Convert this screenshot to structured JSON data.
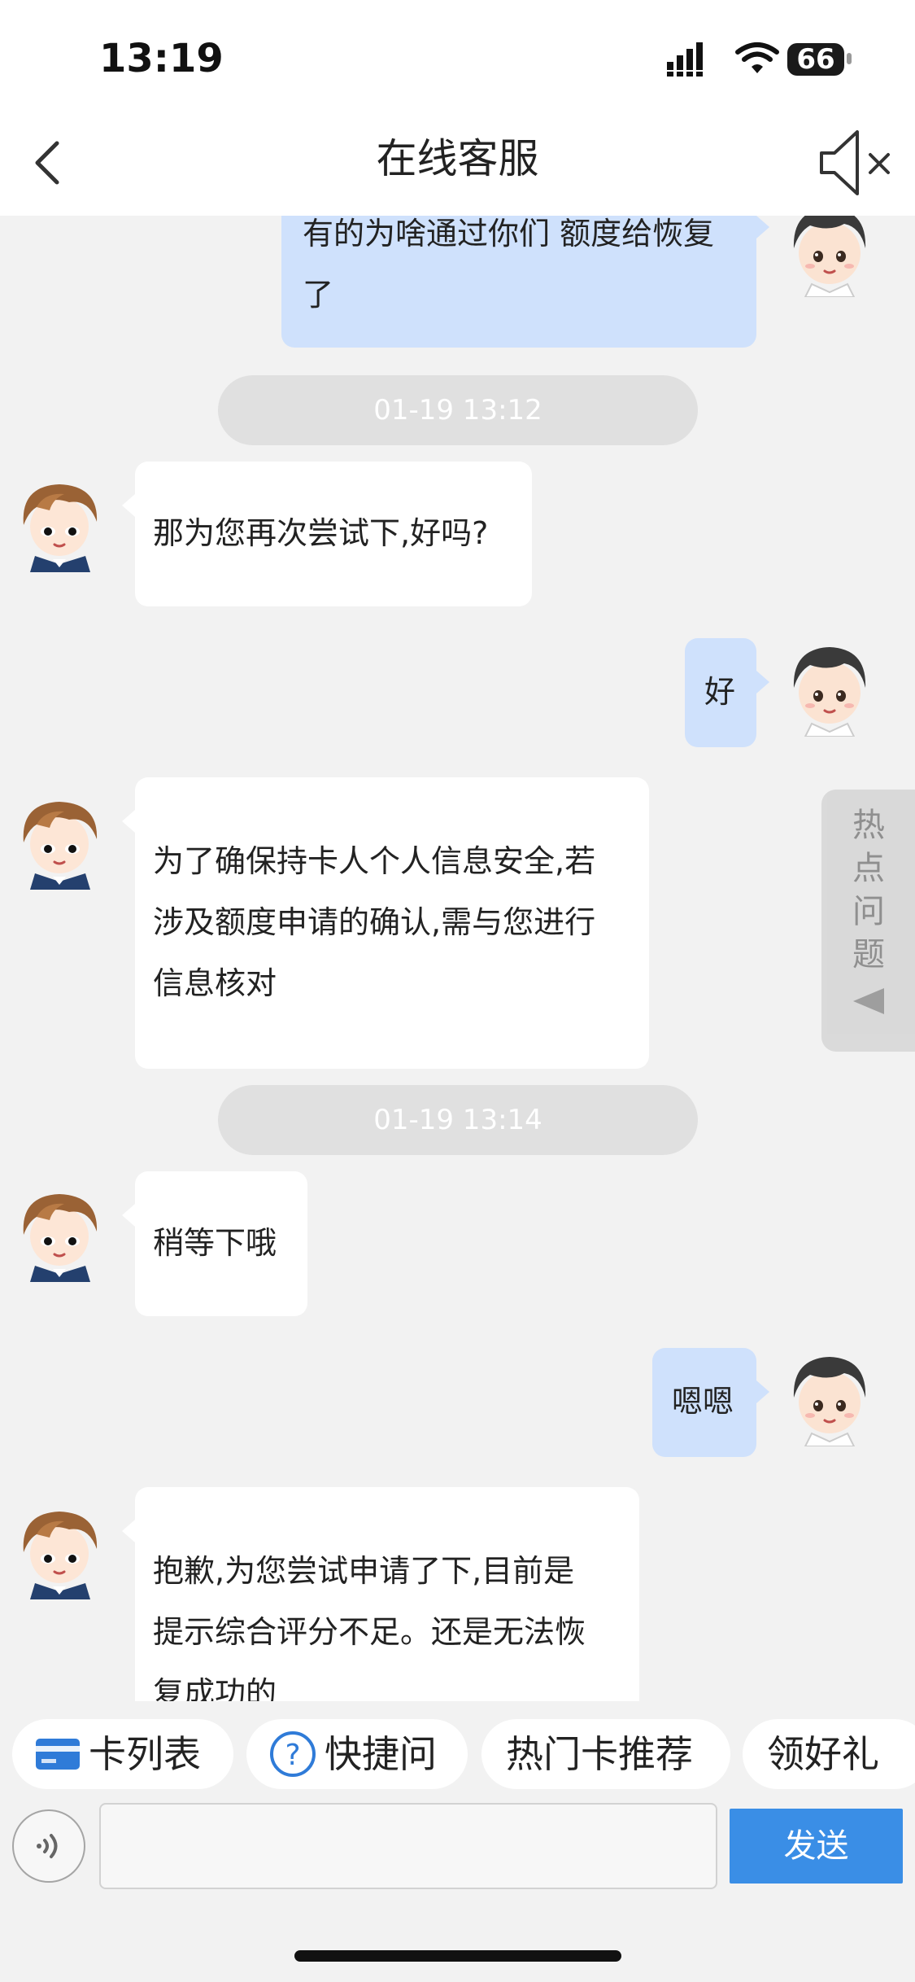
{
  "status_bar": {
    "time": "13:19",
    "battery": "66"
  },
  "header": {
    "title": "在线客服"
  },
  "messages": [
    {
      "lines": [
        "有的为啥通过你们 额度给恢复",
        "了"
      ]
    },
    {
      "time": "01-19 13:12"
    },
    {
      "lines": [
        "那为您再次尝试下,好吗?"
      ]
    },
    {
      "lines": [
        "好"
      ]
    },
    {
      "lines": [
        "为了确保持卡人个人信息安全,若",
        "涉及额度申请的确认,需与您进行",
        "信息核对"
      ]
    },
    {
      "time": "01-19 13:14"
    },
    {
      "lines": [
        "稍等下哦"
      ]
    },
    {
      "lines": [
        "嗯嗯"
      ]
    },
    {
      "lines": [
        "抱歉,为您尝试申请了下,目前是",
        "提示综合评分不足。还是无法恢",
        "复成功的"
      ]
    }
  ],
  "hot_questions_tab": {
    "label": "热点问题"
  },
  "quick_actions": [
    {
      "label": "卡列表",
      "icon": "card-icon"
    },
    {
      "label": "快捷问",
      "icon": "question-icon"
    },
    {
      "label": "热门卡推荐"
    },
    {
      "label": "领好礼"
    }
  ],
  "input": {
    "placeholder": "",
    "value": ""
  },
  "send_button": {
    "label": "发送"
  },
  "colors": {
    "accent": "#3a8ee6",
    "user_bubble": "#cfe1fc",
    "agent_bubble": "#ffffff",
    "background": "#f2f2f2"
  }
}
